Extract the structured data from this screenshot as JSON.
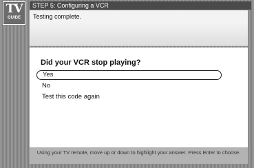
{
  "header": {
    "logo_tv": "TV",
    "logo_guide": "GUIDE",
    "title": "STEP 5: Configuring a VCR"
  },
  "status": {
    "message": "Testing complete."
  },
  "question": {
    "text": "Did your VCR stop playing?",
    "options": [
      {
        "label": "Yes",
        "selected": true
      },
      {
        "label": "No",
        "selected": false
      },
      {
        "label": "Test this code again",
        "selected": false
      }
    ]
  },
  "help": {
    "text": "Using your TV remote, move up or down to highlight your answer. Press Enter to choose."
  }
}
